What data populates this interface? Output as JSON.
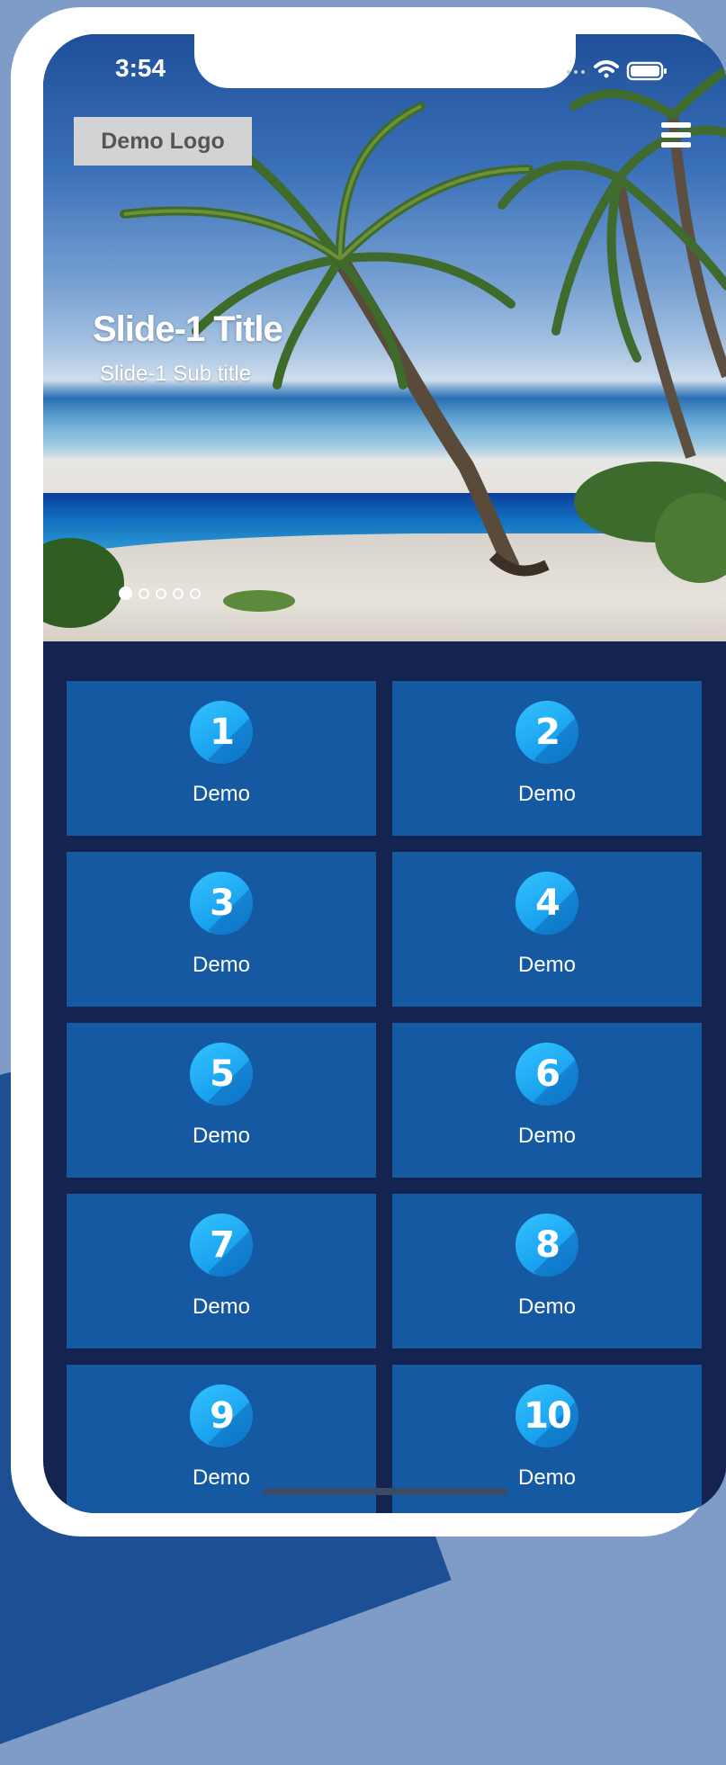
{
  "status_bar": {
    "time": "3:54"
  },
  "header": {
    "logo_text": "Demo Logo",
    "menu_icon": "hamburger-menu-icon"
  },
  "slider": {
    "title": "Slide-1 Title",
    "subtitle": "Slide-1 Sub title",
    "slide_count": 5,
    "active_index": 0
  },
  "grid": {
    "items": [
      {
        "number": "1",
        "label": "Demo"
      },
      {
        "number": "2",
        "label": "Demo"
      },
      {
        "number": "3",
        "label": "Demo"
      },
      {
        "number": "4",
        "label": "Demo"
      },
      {
        "number": "5",
        "label": "Demo"
      },
      {
        "number": "6",
        "label": "Demo"
      },
      {
        "number": "7",
        "label": "Demo"
      },
      {
        "number": "8",
        "label": "Demo"
      },
      {
        "number": "9",
        "label": "Demo"
      },
      {
        "number": "10",
        "label": "Demo"
      }
    ]
  },
  "colors": {
    "background": "#7f9cc8",
    "screen": "#152351",
    "tile": "#1659a3",
    "badge": "#1aa6f0"
  }
}
